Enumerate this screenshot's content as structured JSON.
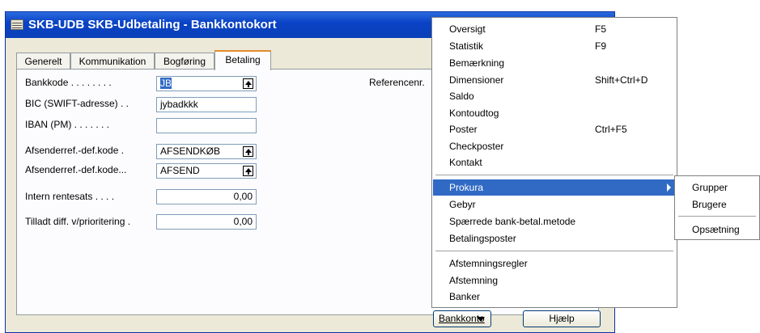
{
  "window": {
    "title": "SKB-UDB SKB-Udbetaling - Bankkontokort"
  },
  "tabs": [
    "Generelt",
    "Kommunikation",
    "Bogføring",
    "Betaling"
  ],
  "fields": {
    "bankkode": {
      "label": "Bankkode . . . . . . . .",
      "value": "JB"
    },
    "bic": {
      "label": "BIC (SWIFT-adresse) . .",
      "value": "jybadkkk"
    },
    "iban": {
      "label": "IBAN (PM) . . . . . . .",
      "value": ""
    },
    "afsender_def_kode": {
      "label": "Afsenderref.-def.kode  .",
      "value": "AFSENDKØB"
    },
    "afsender_def_kode2": {
      "label": "Afsenderref.-def.kode...",
      "value": "AFSEND"
    },
    "intern_rentesats": {
      "label": "Intern rentesats . . . .",
      "value": "0,00"
    },
    "tilladt_diff": {
      "label": "Tilladt diff. v/prioritering .",
      "value": "0,00"
    },
    "referencenr": {
      "label": "Referencenr."
    }
  },
  "buttons": {
    "bankkonto": "Bankkonto",
    "hjaelp": "Hjælp"
  },
  "menu": {
    "items": [
      {
        "label": "Oversigt",
        "shortcut": "F5"
      },
      {
        "label": "Statistik",
        "shortcut": "F9"
      },
      {
        "label": "Bemærkning",
        "shortcut": ""
      },
      {
        "label": "Dimensioner",
        "shortcut": "Shift+Ctrl+D"
      },
      {
        "label": "Saldo",
        "shortcut": ""
      },
      {
        "label": "Kontoudtog",
        "shortcut": ""
      },
      {
        "label": "Poster",
        "shortcut": "Ctrl+F5"
      },
      {
        "label": "Checkposter",
        "shortcut": ""
      },
      {
        "label": "Kontakt",
        "shortcut": ""
      },
      {
        "label": "Prokura",
        "shortcut": ""
      },
      {
        "label": "Gebyr",
        "shortcut": ""
      },
      {
        "label": "Spærrede bank-betal.metode",
        "shortcut": ""
      },
      {
        "label": "Betalingsposter",
        "shortcut": ""
      },
      {
        "label": "Afstemningsregler",
        "shortcut": ""
      },
      {
        "label": "Afstemning",
        "shortcut": ""
      },
      {
        "label": "Banker",
        "shortcut": ""
      }
    ]
  },
  "submenu": {
    "items": [
      "Grupper",
      "Brugere",
      "Opsætning"
    ]
  },
  "colors": {
    "titlebar": "#0a43c6",
    "highlight": "#316ac5",
    "active_tab_accent": "#e68b2c"
  }
}
